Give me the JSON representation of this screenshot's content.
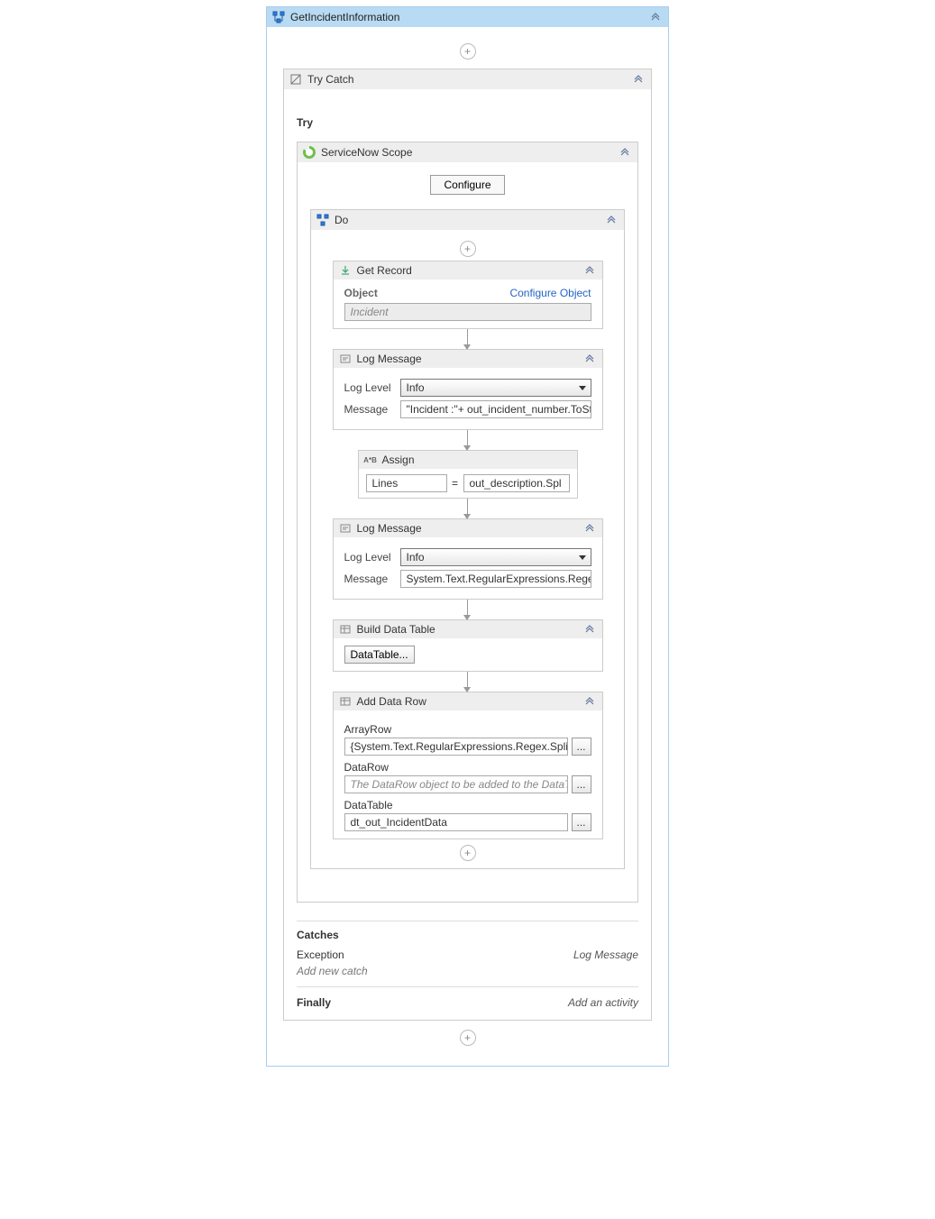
{
  "outer": {
    "title": "GetIncidentInformation"
  },
  "tryCatch": {
    "title": "Try Catch",
    "tryLabel": "Try",
    "catchesLabel": "Catches",
    "catchRow": {
      "type": "Exception",
      "handler": "Log Message"
    },
    "addNewCatch": "Add new catch",
    "finallyLabel": "Finally",
    "finallyPlaceholder": "Add an activity"
  },
  "scope": {
    "title": "ServiceNow Scope",
    "configureButton": "Configure"
  },
  "doSeq": {
    "title": "Do"
  },
  "getRecord": {
    "title": "Get Record",
    "objectLabel": "Object",
    "configureLink": "Configure Object",
    "objectValue": "Incident"
  },
  "logMessage1": {
    "title": "Log Message",
    "logLevelLabel": "Log Level",
    "logLevelValue": "Info",
    "messageLabel": "Message",
    "messageValue": "\"Incident :\"+ out_incident_number.ToString"
  },
  "assign": {
    "title": "Assign",
    "left": "Lines",
    "right": "out_description.Spl"
  },
  "logMessage2": {
    "title": "Log Message",
    "logLevelLabel": "Log Level",
    "logLevelValue": "Info",
    "messageLabel": "Message",
    "messageValue": "System.Text.RegularExpressions.Regex.Split"
  },
  "buildDataTable": {
    "title": "Build Data Table",
    "button": "DataTable..."
  },
  "addDataRow": {
    "title": "Add Data Row",
    "arrayRowLabel": "ArrayRow",
    "arrayRowValue": "{System.Text.RegularExpressions.Regex.Split(Lines(",
    "dataRowLabel": "DataRow",
    "dataRowPlaceholder": "The DataRow object to be added to the DataTable. ",
    "dataTableLabel": "DataTable",
    "dataTableValue": "dt_out_IncidentData",
    "browse": "..."
  }
}
